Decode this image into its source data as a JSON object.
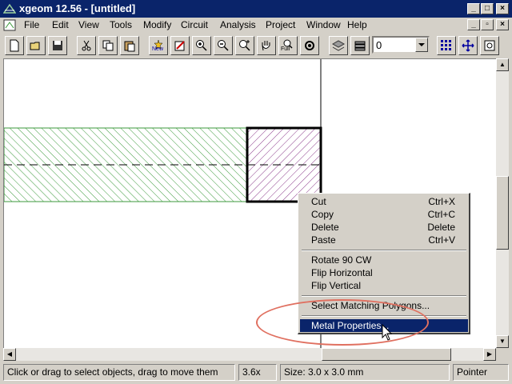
{
  "window": {
    "title": "xgeom 12.56 - [untitled]"
  },
  "menu": [
    "File",
    "Edit",
    "View",
    "Tools",
    "Modify",
    "Circuit",
    "Analysis",
    "Project",
    "Window",
    "Help"
  ],
  "toolbar": {
    "level_value": "0",
    "buttons": [
      "new-file-icon",
      "open-folder-icon",
      "save-icon",
      "cut-icon",
      "copy-icon",
      "paste-icon",
      "new-project-icon",
      "edit-icon",
      "zoom-in-icon",
      "zoom-out-icon",
      "zoom-area-icon",
      "pan-hand-icon",
      "zoom-full-icon",
      "settings-icon",
      "layer-3d-icon",
      "stack-icon",
      "grid-icon",
      "move-icon",
      "snap-icon"
    ],
    "new_label": "New",
    "full_label": "Full"
  },
  "context_menu": {
    "groups": [
      [
        {
          "label": "Cut",
          "shortcut": "Ctrl+X"
        },
        {
          "label": "Copy",
          "shortcut": "Ctrl+C"
        },
        {
          "label": "Delete",
          "shortcut": "Delete"
        },
        {
          "label": "Paste",
          "shortcut": "Ctrl+V"
        }
      ],
      [
        {
          "label": "Rotate 90 CW",
          "shortcut": ""
        },
        {
          "label": "Flip Horizontal",
          "shortcut": ""
        },
        {
          "label": "Flip Vertical",
          "shortcut": ""
        }
      ],
      [
        {
          "label": "Select Matching Polygons...",
          "shortcut": ""
        }
      ],
      [
        {
          "label": "Metal Properties...",
          "shortcut": "",
          "highlighted": true
        }
      ]
    ]
  },
  "status": {
    "hint": "Click or drag to select objects, drag to move them",
    "zoom": "3.6x",
    "size": "Size: 3.0 x 3.0 mm",
    "mode": "Pointer"
  },
  "colors": {
    "titlebar": "#0a246a",
    "green_hatch": "#3c9a3c",
    "purple_hatch": "#8a3a8a",
    "highlight": "#0a246a",
    "callout": "#e07060"
  }
}
